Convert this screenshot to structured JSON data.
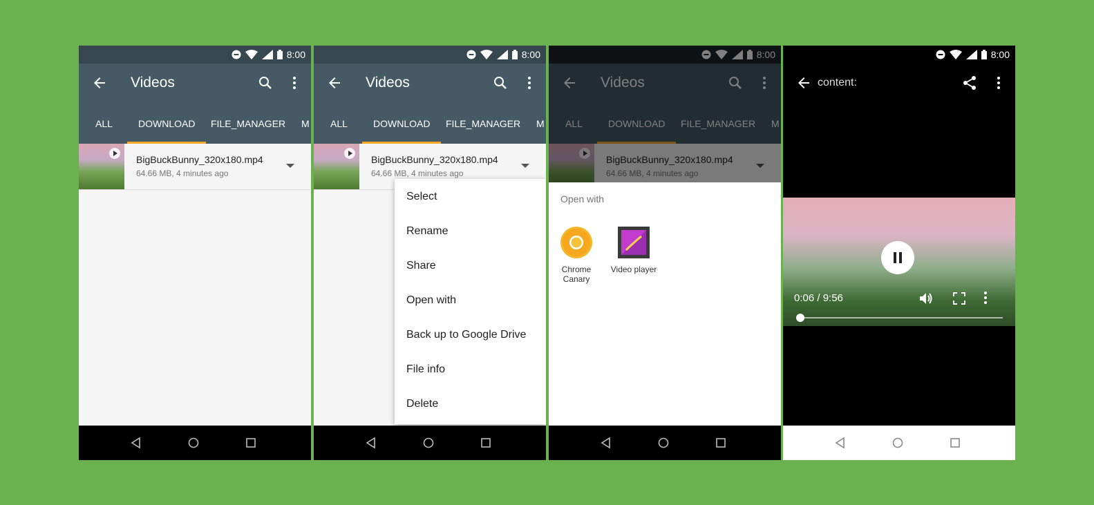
{
  "status": {
    "time": "8:00"
  },
  "screens": [
    {
      "title": "Videos",
      "tabs": [
        "ALL",
        "DOWNLOAD",
        "FILE_MANAGER",
        "M"
      ],
      "file": {
        "name": "BigBuckBunny_320x180.mp4",
        "meta": "64.66 MB, 4 minutes ago"
      }
    },
    {
      "title": "Videos",
      "tabs": [
        "ALL",
        "DOWNLOAD",
        "FILE_MANAGER",
        "M"
      ],
      "file": {
        "name": "BigBuckBunny_320x180.mp4",
        "meta": "64.66 MB, 4 minutes ago"
      },
      "menu": [
        "Select",
        "Rename",
        "Share",
        "Open with",
        "Back up to Google Drive",
        "File info",
        "Delete"
      ]
    },
    {
      "title": "Videos",
      "tabs": [
        "ALL",
        "DOWNLOAD",
        "FILE_MANAGER",
        "M"
      ],
      "file": {
        "name": "BigBuckBunny_320x180.mp4",
        "meta": "64.66 MB, 4 minutes ago"
      },
      "open_with": {
        "title": "Open with",
        "apps": [
          {
            "label": "Chrome Canary",
            "icon": "chrome-canary-icon"
          },
          {
            "label": "Video player",
            "icon": "video-player-icon"
          }
        ]
      }
    },
    {
      "title": "content:",
      "player": {
        "time": "0:06 / 9:56",
        "progress": 0.01
      }
    }
  ],
  "colors": {
    "background": "#6ab150",
    "appbar": "#455a64",
    "tab_indicator": "#f9a825"
  }
}
